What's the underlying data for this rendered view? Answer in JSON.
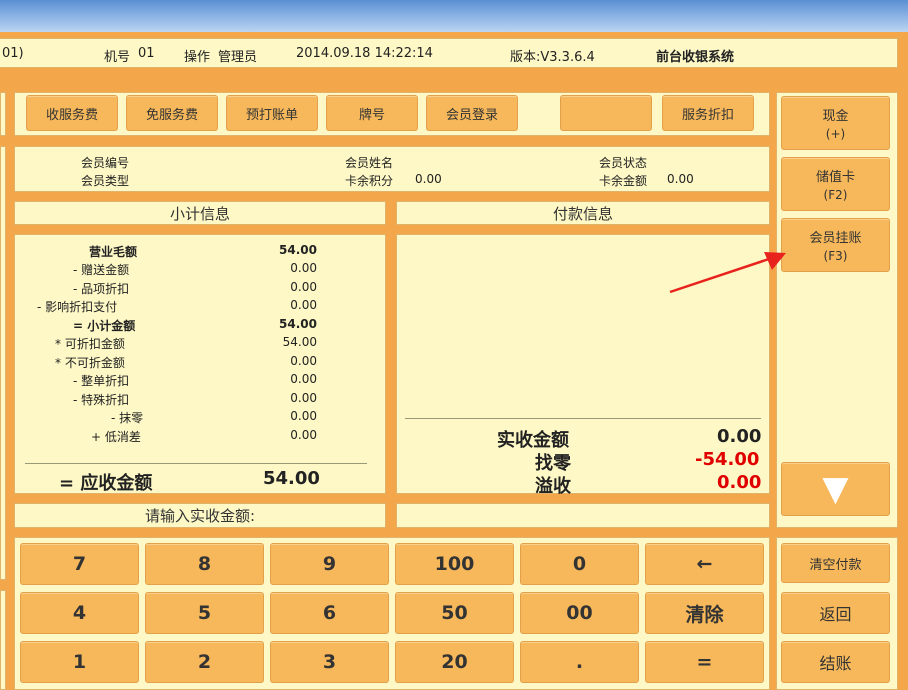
{
  "header": {
    "left_fragment": "01)",
    "machine_label": "机号",
    "machine_no": "01",
    "operator_label": "操作",
    "operator": "管理员",
    "datetime": "2014.09.18 14:22:14",
    "version": "版本:V3.3.6.4",
    "system_name": "前台收银系统"
  },
  "toolbar": [
    "收服务费",
    "免服务费",
    "预打账单",
    "牌号",
    "会员登录",
    "",
    "服务折扣"
  ],
  "member": {
    "id_label": "会员编号",
    "type_label": "会员类型",
    "name_label": "会员姓名",
    "points_label": "卡余积分",
    "points_value": "0.00",
    "status_label": "会员状态",
    "balance_label": "卡余金额",
    "balance_value": "0.00"
  },
  "subtotal_title": "小计信息",
  "payment_title": "付款信息",
  "subtotal_rows": [
    {
      "label": "营业毛额",
      "value": "54.00",
      "bold": true
    },
    {
      "label": "- 赠送金额",
      "value": "0.00"
    },
    {
      "label": "- 品项折扣",
      "value": "0.00"
    },
    {
      "label": "- 影响折扣支付",
      "value": "0.00"
    },
    {
      "label": "= 小计金额",
      "value": "54.00",
      "bold": true
    },
    {
      "label": "* 可折扣金额",
      "value": "54.00"
    },
    {
      "label": "* 不可折金额",
      "value": "0.00"
    },
    {
      "label": "- 整单折扣",
      "value": "0.00"
    },
    {
      "label": "- 特殊折扣",
      "value": "0.00"
    },
    {
      "label": "- 抹零",
      "value": "0.00"
    },
    {
      "label": "+ 低消差",
      "value": "0.00"
    }
  ],
  "receivable": {
    "label": "= 应收金额",
    "value": "54.00"
  },
  "payment_summary": {
    "paid_label": "实收金额",
    "paid_value": "0.00",
    "change_label": "找零",
    "change_value": "-54.00",
    "overflow_label": "溢收",
    "overflow_value": "0.00"
  },
  "prompt": "请输入实收金额:",
  "payment_methods": [
    {
      "label": "现金",
      "key": "(+)"
    },
    {
      "label": "储值卡",
      "key": "(F2)"
    },
    {
      "label": "会员挂账",
      "key": "(F3)"
    }
  ],
  "scroll_down": "▼",
  "keypad": [
    [
      "7",
      "8",
      "9",
      "100",
      "0",
      "←"
    ],
    [
      "4",
      "5",
      "6",
      "50",
      "00",
      "清除"
    ],
    [
      "1",
      "2",
      "3",
      "20",
      ".",
      "="
    ]
  ],
  "actions": [
    "清空付款",
    "返回",
    "结账"
  ],
  "colors": {
    "button": "#f6b85a",
    "panel": "#fdf8c6",
    "background": "#f4a64a",
    "negative": "#e00000",
    "arrow": "#e8231e"
  }
}
